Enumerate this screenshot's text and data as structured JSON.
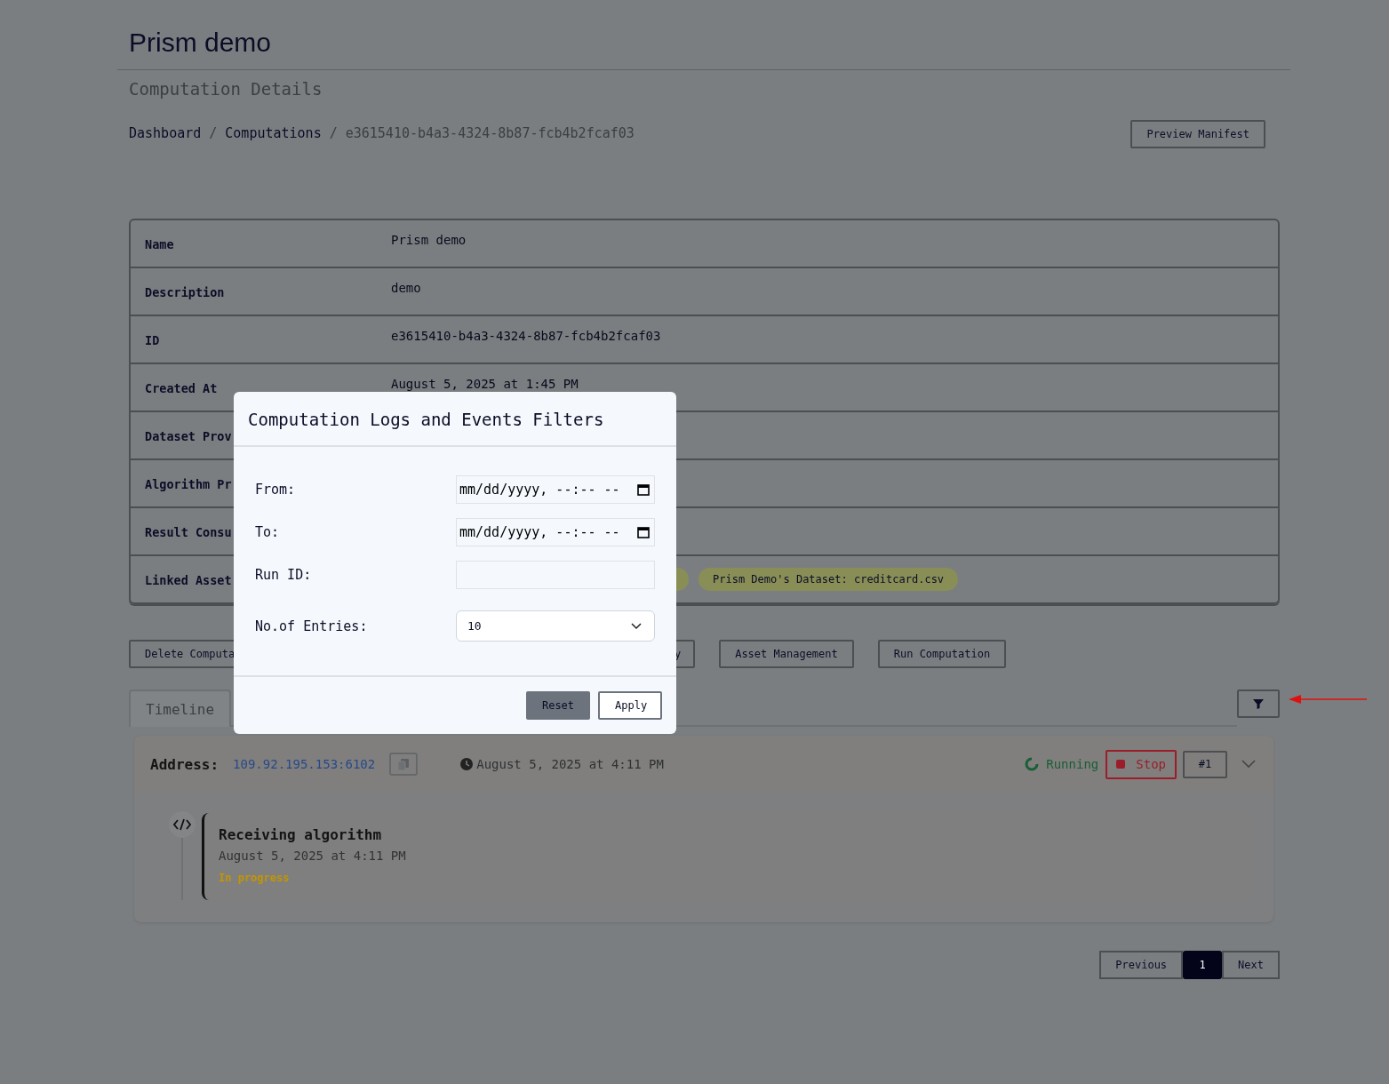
{
  "header": {
    "title": "Prism demo",
    "subtitle": "Computation Details"
  },
  "breadcrumbs": {
    "separator": "/",
    "items": [
      {
        "label": "Dashboard",
        "current": false
      },
      {
        "label": "Computations",
        "current": false
      },
      {
        "label": "e3615410-b4a3-4324-8b87-fcb4b2fcaf03",
        "current": true
      }
    ]
  },
  "top_actions": [
    "Preview Manifest"
  ],
  "details": [
    {
      "label": "Name",
      "value": "Prism demo"
    },
    {
      "label": "Description",
      "value": "demo"
    },
    {
      "label": "ID",
      "value": "e3615410-b4a3-4324-8b87-fcb4b2fcaf03"
    },
    {
      "label": "Created At",
      "value": "August 5, 2025 at 1:45 PM"
    },
    {
      "label": "Dataset Prov"
    },
    {
      "label": "Algorithm Pr"
    },
    {
      "label": "Result Consu"
    },
    {
      "label": "Linked Asset",
      "badges": [
        "Prism Demo's Dataset: creditcard.csv"
      ]
    }
  ],
  "actions": [
    {
      "label": "Delete Computa",
      "kind": "plain"
    },
    {
      "label": "y",
      "kind": "covered"
    },
    {
      "label": "Asset Management",
      "kind": "plain"
    },
    {
      "label": "Run Computation",
      "kind": "plain"
    }
  ],
  "tabs": [
    {
      "label": "Timeline",
      "selected": true
    }
  ],
  "run": {
    "address_label": "Address:",
    "address": "109.92.195.153:6102",
    "started": "August 5, 2025 at 4:11 PM",
    "status": "Running",
    "stop_label": "Stop",
    "run_number": "#1",
    "expanded": false,
    "events": [
      {
        "title": "Receiving algorithm",
        "time": "August 5, 2025 at 4:11 PM",
        "status": "In progress"
      }
    ]
  },
  "pagination": {
    "previous": "Previous",
    "pages": [
      {
        "label": "1",
        "selected": true
      }
    ],
    "next": "Next"
  },
  "dialog": {
    "title": "Computation Logs and Events Filters",
    "fields": [
      {
        "label": "From:",
        "kind": "datetime",
        "value": "mm/dd/yyyy, --:-- --"
      },
      {
        "label": "To:",
        "kind": "datetime",
        "value": "mm/dd/yyyy, --:-- --"
      },
      {
        "label": "Run ID:",
        "kind": "text"
      },
      {
        "label": "No.of Entries:",
        "kind": "select",
        "value": "10"
      }
    ],
    "buttons": [
      {
        "label": "Reset",
        "kind": "secondary"
      },
      {
        "label": "Apply",
        "kind": "primary"
      }
    ]
  }
}
